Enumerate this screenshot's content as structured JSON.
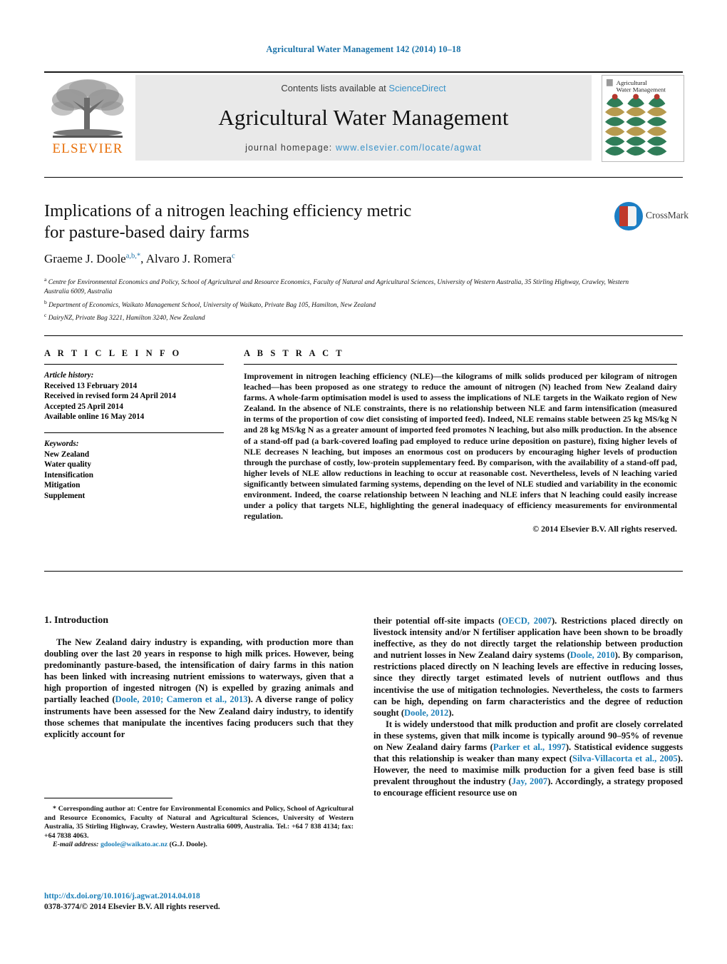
{
  "running_head": "Agricultural Water Management 142 (2014) 10–18",
  "masthead": {
    "contents_prefix": "Contents lists available at ",
    "sciencedirect": "ScienceDirect",
    "journal_title": "Agricultural Water Management",
    "homepage_prefix": "journal homepage: ",
    "homepage_url": "www.elsevier.com/locate/agwat",
    "publisher": "ELSEVIER",
    "cover_title_line1": "Agricultural",
    "cover_title_line2": "Water Management",
    "colors": {
      "link": "#3892c9",
      "publisher_orange": "#e8700a",
      "running_head": "#1b72a8",
      "panel_gray": "#e9e9e9"
    }
  },
  "crossmark": {
    "label": "CrossMark"
  },
  "article": {
    "title_line1": "Implications of a nitrogen leaching efficiency metric",
    "title_line2": "for pasture-based dairy farms",
    "authors": [
      {
        "name": "Graeme J. Doole",
        "marks": "a,b,*"
      },
      {
        "name": "Alvaro J. Romera",
        "marks": "c"
      }
    ],
    "affiliations": [
      {
        "mark": "a",
        "text": "Centre for Environmental Economics and Policy, School of Agricultural and Resource Economics, Faculty of Natural and Agricultural Sciences, University of Western Australia, 35 Stirling Highway, Crawley, Western Australia 6009, Australia"
      },
      {
        "mark": "b",
        "text": "Department of Economics, Waikato Management School, University of Waikato, Private Bag 105, Hamilton, New Zealand"
      },
      {
        "mark": "c",
        "text": "DairyNZ, Private Bag 3221, Hamilton 3240, New Zealand"
      }
    ]
  },
  "article_info": {
    "heading": "A R T I C L E   I N F O",
    "history_label": "Article history:",
    "history": [
      "Received 13 February 2014",
      "Received in revised form 24 April 2014",
      "Accepted 25 April 2014",
      "Available online 16 May 2014"
    ],
    "keywords_label": "Keywords:",
    "keywords": [
      "New Zealand",
      "Water quality",
      "Intensification",
      "Mitigation",
      "Supplement"
    ]
  },
  "abstract": {
    "heading": "A B S T R A C T",
    "text": "Improvement in nitrogen leaching efficiency (NLE)—the kilograms of milk solids produced per kilogram of nitrogen leached—has been proposed as one strategy to reduce the amount of nitrogen (N) leached from New Zealand dairy farms. A whole-farm optimisation model is used to assess the implications of NLE targets in the Waikato region of New Zealand. In the absence of NLE constraints, there is no relationship between NLE and farm intensification (measured in terms of the proportion of cow diet consisting of imported feed). Indeed, NLE remains stable between 25 kg MS/kg N and 28 kg MS/kg N as a greater amount of imported feed promotes N leaching, but also milk production. In the absence of a stand-off pad (a bark-covered loafing pad employed to reduce urine deposition on pasture), fixing higher levels of NLE decreases N leaching, but imposes an enormous cost on producers by encouraging higher levels of production through the purchase of costly, low-protein supplementary feed. By comparison, with the availability of a stand-off pad, higher levels of NLE allow reductions in leaching to occur at reasonable cost. Nevertheless, levels of N leaching varied significantly between simulated farming systems, depending on the level of NLE studied and variability in the economic environment. Indeed, the coarse relationship between N leaching and NLE infers that N leaching could easily increase under a policy that targets NLE, highlighting the general inadequacy of efficiency measurements for environmental regulation.",
    "copyright": "© 2014 Elsevier B.V. All rights reserved."
  },
  "introduction": {
    "heading": "1.  Introduction",
    "left_para1_a": "The New Zealand dairy industry is expanding, with production more than doubling over the last 20 years in response to high milk prices. However, being predominantly pasture-based, the intensification of dairy farms in this nation has been linked with increasing nutrient emissions to waterways, given that a high proportion of ingested nitrogen (N) is expelled by grazing animals and partially leached (",
    "left_ref1": "Doole, 2010; Cameron et al., 2013",
    "left_para1_b": "). A diverse range of policy instruments have been assessed for the New Zealand dairy industry, to identify those schemes that manipulate the incentives facing producers such that they explicitly account for",
    "right_para1_a": "their potential off-site impacts (",
    "right_ref1": "OECD, 2007",
    "right_para1_b": "). Restrictions placed directly on livestock intensity and/or N fertiliser application have been shown to be broadly ineffective, as they do not directly target the relationship between production and nutrient losses in New Zealand dairy systems (",
    "right_ref2": "Doole, 2010",
    "right_para1_c": "). By comparison, restrictions placed directly on N leaching levels are effective in reducing losses, since they directly target estimated levels of nutrient outflows and thus incentivise the use of mitigation technologies. Nevertheless, the costs to farmers can be high, depending on farm characteristics and the degree of reduction sought (",
    "right_ref3": "Doole, 2012",
    "right_para1_d": ").",
    "right_para2_a": "It is widely understood that milk production and profit are closely correlated in these systems, given that milk income is typically around 90–95% of revenue on New Zealand dairy farms (",
    "right_ref4": "Parker et al., 1997",
    "right_para2_b": "). Statistical evidence suggests that this relationship is weaker than many expect (",
    "right_ref5": "Silva-Villacorta et al., 2005",
    "right_para2_c": "). However, the need to maximise milk production for a given feed base is still prevalent throughout the industry (",
    "right_ref6": "Jay, 2007",
    "right_para2_d": "). Accordingly, a strategy proposed to encourage efficient resource use on"
  },
  "footnote": {
    "marker": "*",
    "corresponding": "Corresponding author at: Centre for Environmental Economics and Policy, School of Agricultural and Resource Economics, Faculty of Natural and Agricultural Sciences, University of Western Australia, 35 Stirling Highway, Crawley, Western Australia 6009, Australia. Tel.: +64 7 838 4134; fax: +64 7838 4063.",
    "email_label": "E-mail address:",
    "email": "gdoole@waikato.ac.nz",
    "email_suffix": "(G.J. Doole).",
    "doi": "http://dx.doi.org/10.1016/j.agwat.2014.04.018",
    "issn": "0378-3774/© 2014 Elsevier B.V. All rights reserved."
  }
}
